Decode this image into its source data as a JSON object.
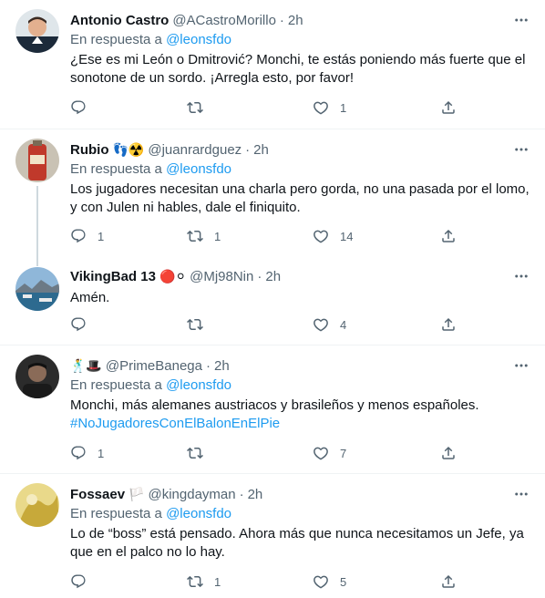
{
  "reply_prefix": "En respuesta a",
  "tweets": [
    {
      "name": "Antonio Castro",
      "handle": "@ACastroMorillo",
      "time": "2h",
      "reply_to": "@leonsfdo",
      "text": "¿Ese es mi León o Dmitrović? Monchi, te estás poniendo más fuerte que el sonotone de un sordo. ¡Arregla esto, por favor!",
      "replies": "",
      "retweets": "",
      "likes": "1"
    },
    {
      "name": "Rubio",
      "name_emojis": "👣☢️",
      "handle": "@juanrardguez",
      "time": "2h",
      "reply_to": "@leonsfdo",
      "text": "Los jugadores necesitan una charla pero gorda, no una pasada por el lomo, y con Julen ni hables, dale el finiquito.",
      "replies": "1",
      "retweets": "1",
      "likes": "14"
    },
    {
      "name": "VikingBad 13",
      "name_emojis": "🔴⚪",
      "handle": "@Mj98Nin",
      "time": "2h",
      "text": "Amén.",
      "replies": "",
      "retweets": "",
      "likes": "4"
    },
    {
      "name": "",
      "name_emojis": "🕺🎩",
      "handle": "@PrimeBanega",
      "time": "2h",
      "reply_to": "@leonsfdo",
      "text": "Monchi, más alemanes austriacos y brasileños y menos españoles.",
      "hashtag": "#NoJugadoresConElBalonEnElPie",
      "replies": "1",
      "retweets": "",
      "likes": "7"
    },
    {
      "name": "Fossaev",
      "name_emojis": "🏳️",
      "handle": "@kingdayman",
      "time": "2h",
      "reply_to": "@leonsfdo",
      "text": "Lo de “boss” está pensado. Ahora más que nunca necesitamos un Jefe, ya que en el palco no lo hay.",
      "replies": "",
      "retweets": "1",
      "likes": "5"
    }
  ],
  "icons": {
    "reply": "reply-icon",
    "retweet": "retweet-icon",
    "like": "heart-icon",
    "share": "share-icon",
    "more": "more-icon"
  },
  "colors": {
    "text": "#0f1419",
    "secondary": "#536471",
    "link": "#1d9bf0",
    "separator": "#eff3f4",
    "thread_line": "#cfd9de"
  }
}
